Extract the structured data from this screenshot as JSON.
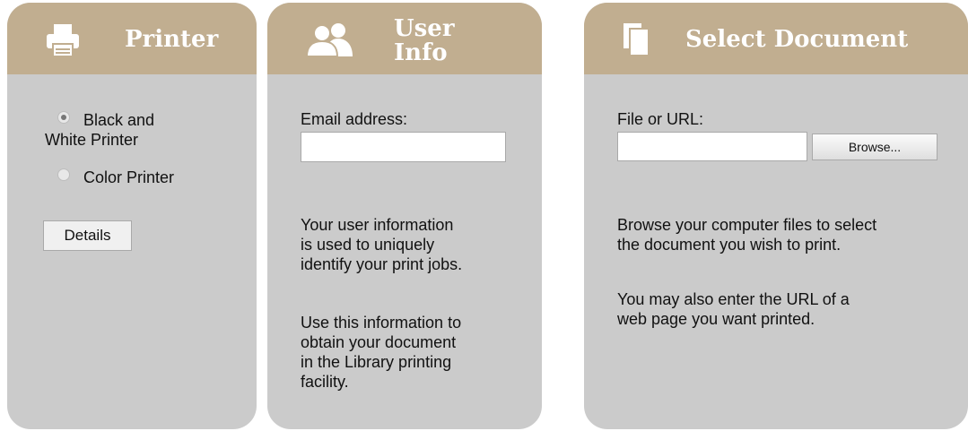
{
  "printer_panel": {
    "title": "Printer",
    "options": [
      {
        "label": "Black and White Printer",
        "line1": "Black and",
        "line2": "White Printer",
        "selected": true
      },
      {
        "label": "Color Printer",
        "selected": false
      }
    ],
    "details_label": "Details"
  },
  "user_panel": {
    "title_line1": "User",
    "title_line2": "Info",
    "email_label": "Email address:",
    "email_value": "",
    "help1": [
      "Your user information",
      "is used to uniquely",
      "identify your print jobs."
    ],
    "help2": [
      "Use this information to",
      "obtain your document",
      "in the Library printing",
      "facility."
    ]
  },
  "document_panel": {
    "title": "Select Document",
    "file_label": "File or URL:",
    "file_value": "",
    "browse_label": "Browse...",
    "help1": [
      "Browse your computer files to select",
      "the document you wish to print."
    ],
    "help2": [
      "You may also enter the URL of a",
      "web page you want printed."
    ]
  },
  "colors": {
    "header": "#c1ae90",
    "panel": "#cbcbcb",
    "title_text": "#ffffff"
  },
  "icons": {
    "printer_panel": "printer-icon",
    "user_panel": "users-icon",
    "document_panel": "document-icon"
  }
}
